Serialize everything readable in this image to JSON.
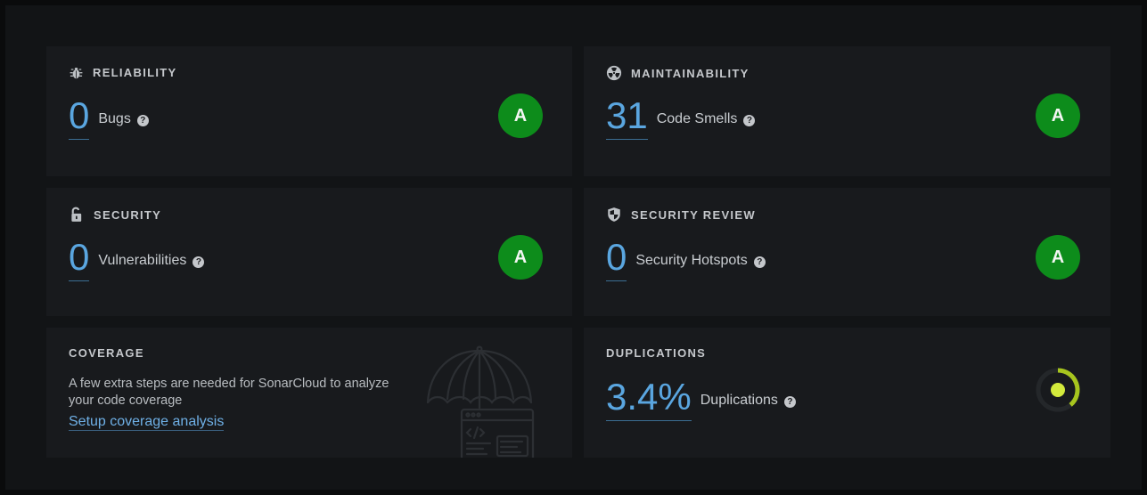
{
  "reliability": {
    "title": "RELIABILITY",
    "icon": "bug-icon",
    "value": "0",
    "label": "Bugs",
    "rating": "A"
  },
  "maintainability": {
    "title": "MAINTAINABILITY",
    "icon": "radiation-icon",
    "value": "31",
    "label": "Code Smells",
    "rating": "A"
  },
  "security": {
    "title": "SECURITY",
    "icon": "unlocked-padlock-icon",
    "value": "0",
    "label": "Vulnerabilities",
    "rating": "A"
  },
  "security_review": {
    "title": "SECURITY REVIEW",
    "icon": "shield-icon",
    "value": "0",
    "label": "Security Hotspots",
    "rating": "A"
  },
  "coverage": {
    "title": "COVERAGE",
    "message": "A few extra steps are needed for SonarCloud to analyze your code coverage",
    "link": "Setup coverage analysis",
    "illustration": "umbrella-code-window-illustration"
  },
  "duplications": {
    "title": "DUPLICATIONS",
    "value": "3.4%",
    "label": "Duplications",
    "graph_fraction": 0.034
  },
  "help_glyph": "?",
  "colors": {
    "rating_a": "#0d8c1b",
    "metric_value": "#5aa6e0",
    "duplication_indicator": "#d3ea3c",
    "duplication_ring": "#a7c51e"
  }
}
